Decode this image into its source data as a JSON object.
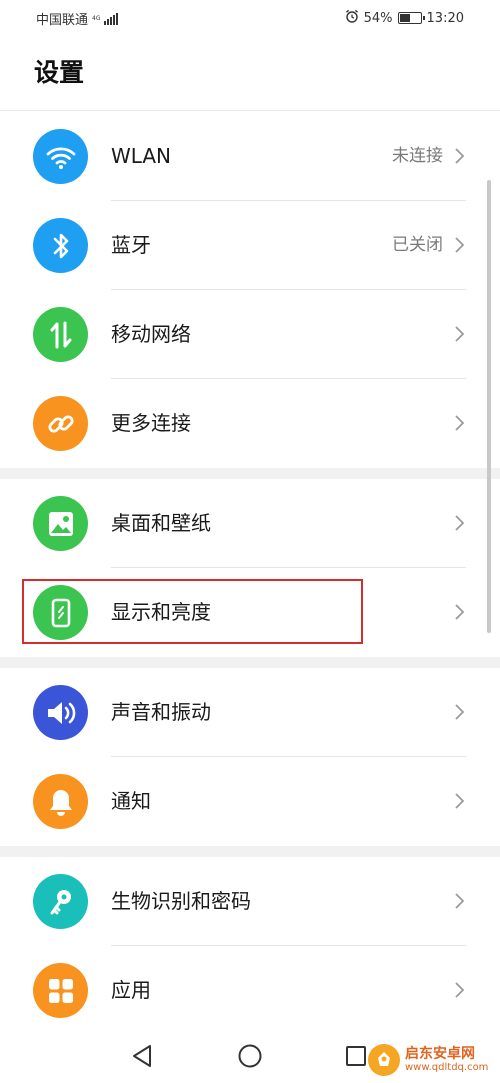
{
  "status_bar": {
    "carrier": "中国联通",
    "network_type": "4G",
    "battery_percent": "54%",
    "battery_level": 0.54,
    "time": "13:20",
    "icons": [
      "alarm-icon",
      "battery-icon",
      "signal-icon"
    ]
  },
  "header": {
    "title": "设置"
  },
  "groups": [
    {
      "items": [
        {
          "label": "WLAN",
          "value": "未连接",
          "icon": "wifi-icon",
          "color": "#1e9ff2"
        },
        {
          "label": "蓝牙",
          "value": "已关闭",
          "icon": "bluetooth-icon",
          "color": "#1e9ff2"
        },
        {
          "label": "移动网络",
          "value": "",
          "icon": "mobile-data-icon",
          "color": "#3cc451"
        },
        {
          "label": "更多连接",
          "value": "",
          "icon": "link-icon",
          "color": "#f7931e"
        }
      ]
    },
    {
      "items": [
        {
          "label": "桌面和壁纸",
          "value": "",
          "icon": "wallpaper-icon",
          "color": "#3cc451"
        },
        {
          "label": "显示和亮度",
          "value": "",
          "icon": "display-icon",
          "color": "#3cc451"
        }
      ]
    },
    {
      "items": [
        {
          "label": "声音和振动",
          "value": "",
          "icon": "sound-icon",
          "color": "#3a55d8"
        },
        {
          "label": "通知",
          "value": "",
          "icon": "bell-icon",
          "color": "#f7931e"
        }
      ]
    },
    {
      "items": [
        {
          "label": "生物识别和密码",
          "value": "",
          "icon": "key-icon",
          "color": "#19bfb8"
        },
        {
          "label": "应用",
          "value": "",
          "icon": "apps-icon",
          "color": "#f7931e"
        }
      ]
    }
  ],
  "nav_bar": {
    "buttons": [
      "back-icon",
      "home-icon",
      "recents-icon"
    ]
  },
  "watermark": {
    "name": "启东安卓网",
    "url": "www.qdltdq.com"
  },
  "colors": {
    "highlight": "#d32f2f",
    "chevron": "#9a9a9a"
  }
}
